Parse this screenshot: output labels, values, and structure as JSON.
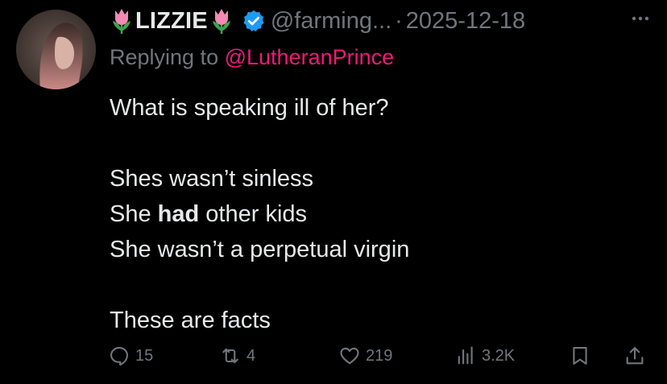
{
  "author": {
    "name": "LIZZIE",
    "handle": "@farming...",
    "separator": "·",
    "date": "2025-12-18",
    "verified": true,
    "decoration_icon": "tulip-emoji"
  },
  "reply": {
    "prefix": "Replying to",
    "mention": "@LutheranPrince"
  },
  "body": {
    "line1": "What is speaking ill of her?",
    "line2": "Shes wasn’t sinless",
    "line3_before": "She ",
    "line3_bold": "had",
    "line3_after": " other kids",
    "line4": "She wasn’t a perpetual virgin",
    "line5": "These are facts"
  },
  "actions": {
    "replies": "15",
    "reposts": "4",
    "likes": "219",
    "views": "3.2K"
  },
  "colors": {
    "background": "#000000",
    "text": "#e7e9ea",
    "muted": "#71767b",
    "mention": "#f0197a",
    "verified": "#1d9bf0"
  }
}
